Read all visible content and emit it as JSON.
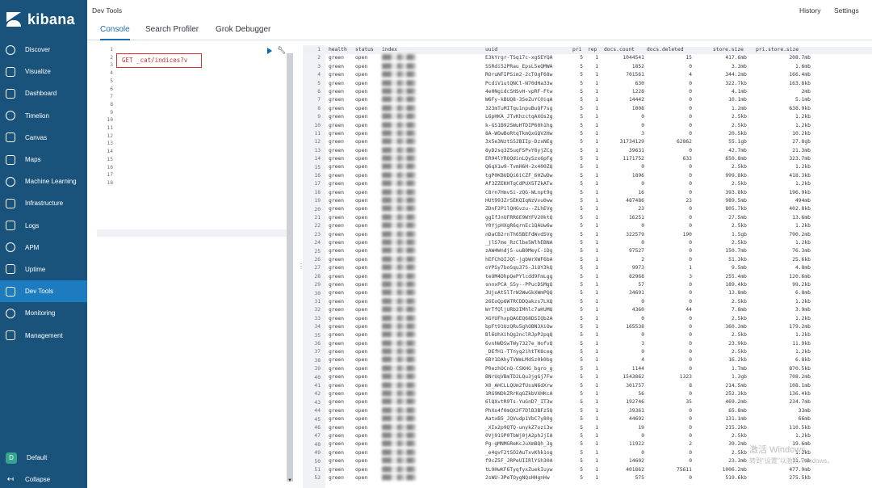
{
  "app": {
    "name": "kibana"
  },
  "nav": {
    "items": [
      {
        "label": "Discover",
        "icon": "compass-icon"
      },
      {
        "label": "Visualize",
        "icon": "bar-chart-icon"
      },
      {
        "label": "Dashboard",
        "icon": "dashboard-icon"
      },
      {
        "label": "Timelion",
        "icon": "shield-icon"
      },
      {
        "label": "Canvas",
        "icon": "canvas-icon"
      },
      {
        "label": "Maps",
        "icon": "map-icon"
      },
      {
        "label": "Machine Learning",
        "icon": "brain-icon"
      },
      {
        "label": "Infrastructure",
        "icon": "infrastructure-icon"
      },
      {
        "label": "Logs",
        "icon": "logs-icon"
      },
      {
        "label": "APM",
        "icon": "apm-icon"
      },
      {
        "label": "Uptime",
        "icon": "uptime-icon"
      },
      {
        "label": "Dev Tools",
        "icon": "wrench-icon",
        "active": true
      },
      {
        "label": "Monitoring",
        "icon": "heartbeat-icon"
      },
      {
        "label": "Management",
        "icon": "gear-icon"
      }
    ],
    "space": {
      "label": "Default",
      "initial": "D"
    },
    "collapse": {
      "label": "Collapse"
    }
  },
  "header": {
    "title": "Dev Tools",
    "history": "History",
    "settings": "Settings"
  },
  "tabs": [
    {
      "label": "Console",
      "active": true
    },
    {
      "label": "Search Profiler",
      "active": false
    },
    {
      "label": "Grok Debugger",
      "active": false
    }
  ],
  "request": {
    "line_count": 18,
    "text": "GET _cat/indices?v"
  },
  "response": {
    "headers": [
      "health",
      "status",
      "index",
      "uuid",
      "pri",
      "rep",
      "docs.count",
      "docs.deleted",
      "store.size",
      "pri.store.size"
    ],
    "rows": [
      [
        "green",
        "open",
        "",
        "E3kYrgr-TSq17c-xgSEYQA",
        "5",
        "1",
        "1044541",
        "15",
        "417.6mb",
        "208.7mb"
      ],
      [
        "green",
        "open",
        "",
        "SSRdi52PRau_EpsL5eQMWA",
        "5",
        "1",
        "1852",
        "0",
        "3.3mb",
        "1.6mb"
      ],
      [
        "green",
        "open",
        "",
        "ROruNFIPSim2-2cTOgF68w",
        "5",
        "1",
        "701561",
        "4",
        "344.2mb",
        "166.4mb"
      ],
      [
        "green",
        "open",
        "",
        "PcdiV1utQNCl-N70dHa33w",
        "5",
        "1",
        "630",
        "0",
        "322.7kb",
        "163.8kb"
      ],
      [
        "green",
        "open",
        "",
        "4e0NgidcSHSvH-vpRF-Ftw",
        "5",
        "1",
        "1228",
        "0",
        "4.1mb",
        "2mb"
      ],
      [
        "green",
        "open",
        "",
        "W6Fy-kBUQ8-3SeZuYC0iqA",
        "5",
        "1",
        "14442",
        "0",
        "10.1mb",
        "5.1mb"
      ],
      [
        "green",
        "open",
        "",
        "323mTuMITqu1npuBuQF7sg",
        "5",
        "1",
        "1008",
        "0",
        "1.2mb",
        "638.9kb"
      ],
      [
        "green",
        "open",
        "",
        "L6pHKA_JTvKhzctqAXOs2g",
        "5",
        "1",
        "0",
        "0",
        "2.5kb",
        "1.2kb"
      ],
      [
        "green",
        "open",
        "",
        "k-GS1B92SWuHTDIP60h1hg",
        "5",
        "1",
        "0",
        "0",
        "2.5kb",
        "1.2kb"
      ],
      [
        "green",
        "open",
        "",
        "8A-WOwBoRtqTkmQxGQV2Hw",
        "5",
        "1",
        "3",
        "0",
        "20.5kb",
        "10.2kb"
      ],
      [
        "green",
        "open",
        "",
        "3x5e3NztS52BIIp-DzxNEg",
        "5",
        "1",
        "31734129",
        "62862",
        "55.1gb",
        "27.8gb"
      ],
      [
        "green",
        "open",
        "",
        "8yD2sq3ZSuqFSPvY8yjZCg",
        "5",
        "1",
        "39631",
        "0",
        "42.7mb",
        "21.3mb"
      ],
      [
        "green",
        "open",
        "",
        "ER94lYROQdinLQySzx6pFg",
        "5",
        "1",
        "1171752",
        "633",
        "650.8mb",
        "323.7mb"
      ],
      [
        "green",
        "open",
        "",
        "Q6qX1w9-TvmH6H-2x400ZQ",
        "5",
        "1",
        "0",
        "0",
        "2.5kb",
        "1.2kb"
      ],
      [
        "green",
        "open",
        "",
        "tgP0KBUDQi6iCZF_6HZwDw",
        "5",
        "1",
        "1896",
        "0",
        "999.8kb",
        "418.3kb"
      ],
      [
        "green",
        "open",
        "",
        "Af3ZZEKHTqCdPUX5TZkATw",
        "5",
        "1",
        "0",
        "0",
        "2.5kb",
        "1.2kb"
      ],
      [
        "green",
        "open",
        "",
        "C8rn7HmvSi-zQG-WLnpt9g",
        "5",
        "1",
        "16",
        "0",
        "393.8kb",
        "196.9kb"
      ],
      [
        "green",
        "open",
        "",
        "HUt993ZrSEKQIqNzVvu0ww",
        "5",
        "1",
        "487486",
        "23",
        "989.5mb",
        "494mb"
      ],
      [
        "green",
        "open",
        "",
        "ZDnF2P1lQHGvzu--ZLhEVg",
        "5",
        "1",
        "23",
        "0",
        "805.7kb",
        "402.8kb"
      ],
      [
        "green",
        "open",
        "",
        "ggIfJnUFRR6E9WYFV20ktQ",
        "5",
        "1",
        "16251",
        "0",
        "27.5mb",
        "13.6mb"
      ],
      [
        "green",
        "open",
        "",
        "Y0YjpHXgR6qrnEc1QAUw6w",
        "5",
        "1",
        "0",
        "0",
        "2.5kb",
        "1.2kb"
      ],
      [
        "green",
        "open",
        "",
        "nDaCB2rnTh65BEFdWvdSVg",
        "5",
        "1",
        "322579",
        "190",
        "1.5gb",
        "790.2mb"
      ],
      [
        "green",
        "open",
        "",
        "_jlS7mo_RzClbe5WlhEBNA",
        "5",
        "1",
        "0",
        "0",
        "2.5kb",
        "1.2kb"
      ],
      [
        "green",
        "open",
        "",
        "zAW4WndjS-uuB0MeyC-iDg",
        "5",
        "1",
        "97527",
        "0",
        "150.7mb",
        "76.3mb"
      ],
      [
        "green",
        "open",
        "",
        "hEFChOIJQl-jgbWrXWF6bA",
        "5",
        "1",
        "2",
        "0",
        "51.3kb",
        "25.6kb"
      ],
      [
        "green",
        "open",
        "",
        "oYPSy7boSqu37S-JiOY3kQ",
        "5",
        "1",
        "9973",
        "1",
        "9.5mb",
        "4.8mb"
      ],
      [
        "green",
        "open",
        "",
        "teOM4DhpQePYlcdd9FmLgg",
        "5",
        "1",
        "82968",
        "3",
        "255.4mb",
        "120.6mb"
      ],
      [
        "green",
        "open",
        "",
        "snnxPCA_SSy--PPucDSMgQ",
        "5",
        "1",
        "57",
        "0",
        "189.4kb",
        "99.2kb"
      ],
      [
        "green",
        "open",
        "",
        "JUjoAt5lTrW2WwGkXWmPQQ",
        "5",
        "1",
        "34691",
        "0",
        "13.8mb",
        "6.8mb"
      ],
      [
        "green",
        "open",
        "",
        "26EoQp6WTRCDDQakzs7LXQ",
        "5",
        "1",
        "0",
        "0",
        "2.5kb",
        "1.2kb"
      ],
      [
        "green",
        "open",
        "",
        "WrTfQljURb2IMhlc7aKUMQ",
        "5",
        "1",
        "4360",
        "44",
        "7.8mb",
        "3.9mb"
      ],
      [
        "green",
        "open",
        "",
        "XGYUFhxpQAGEQ68DSIQb2A",
        "5",
        "1",
        "0",
        "0",
        "2.5kb",
        "1.2kb"
      ],
      [
        "green",
        "open",
        "",
        "bpFt91UzQRu5ghOBN3XiOw",
        "5",
        "1",
        "165538",
        "0",
        "360.3mb",
        "179.2mb"
      ],
      [
        "green",
        "open",
        "",
        "Bl6UhXihQg2nclRJpP2pqQ",
        "5",
        "1",
        "0",
        "0",
        "2.5kb",
        "1.2kb"
      ],
      [
        "green",
        "open",
        "",
        "6vnhWDSwTWy7327e_HofvQ",
        "5",
        "1",
        "3",
        "0",
        "23.9kb",
        "11.9kb"
      ],
      [
        "green",
        "open",
        "",
        "_DEfH1-TTnyq2ihtTK8ceg",
        "5",
        "1",
        "0",
        "0",
        "2.5kb",
        "1.2kb"
      ],
      [
        "green",
        "open",
        "",
        "6BY1DAhyTVWmLMdSz0k0bg",
        "5",
        "1",
        "4",
        "0",
        "16.2kb",
        "6.8kb"
      ],
      [
        "green",
        "open",
        "",
        "P0ezhOCnQ-CSKHG_bgro_g",
        "5",
        "1",
        "1144",
        "0",
        "1.7mb",
        "870.5kb"
      ],
      [
        "green",
        "open",
        "",
        "BNrUqVBmTD2LQu3jgGj7Fw",
        "5",
        "1",
        "1543862",
        "1323",
        "1.3gb",
        "708.2mb"
      ],
      [
        "green",
        "open",
        "",
        "X0_AHCLLQUm2fUssN6dXrw",
        "5",
        "1",
        "301757",
        "8",
        "214.5mb",
        "108.1mb"
      ],
      [
        "green",
        "open",
        "",
        "1RG9NDkZRrKqGZkbVXHKcA",
        "5",
        "1",
        "56",
        "0",
        "252.3kb",
        "136.4kb"
      ],
      [
        "green",
        "open",
        "",
        "6lQXvtR9Ts-YuGnD7_IT3w",
        "5",
        "1",
        "192746",
        "35",
        "469.2mb",
        "234.7mb"
      ],
      [
        "green",
        "open",
        "",
        "PhXs4f0mQX2F7DlB3BFz5Q",
        "5",
        "1",
        "39361",
        "0",
        "65.8mb",
        "33mb"
      ],
      [
        "green",
        "open",
        "",
        "AatxB5_JQVudp1VbC7y80g",
        "5",
        "1",
        "44692",
        "0",
        "131.1mb",
        "66mb"
      ],
      [
        "green",
        "open",
        "",
        "_XIx2p9QTQ-unykZ7ozi3w",
        "5",
        "1",
        "19",
        "0",
        "215.2kb",
        "110.5kb"
      ],
      [
        "green",
        "open",
        "",
        "0Vj91SP0TbWj0jA2phJjIA",
        "5",
        "1",
        "0",
        "0",
        "2.5kb",
        "1.2kb"
      ],
      [
        "green",
        "open",
        "",
        "Pg-gMNMGReKcJuXmBQh_3g",
        "5",
        "1",
        "11922",
        "2",
        "39.2mb",
        "19.6mb"
      ],
      [
        "green",
        "open",
        "",
        "_e4gvF2tSO2AuTxvKhk1og",
        "5",
        "1",
        "0",
        "0",
        "2.5kb",
        "1.2kb"
      ],
      [
        "green",
        "open",
        "",
        "f9cZ5F_JRPeUIIRlYSh30A",
        "5",
        "1",
        "14602",
        "0",
        "23.3mb",
        "11.7mb"
      ],
      [
        "green",
        "open",
        "",
        "tL9HwKF6TyqfyxZuekIuyw",
        "5",
        "1",
        "401862",
        "75611",
        "1006.2mb",
        "477.9mb"
      ],
      [
        "green",
        "open",
        "",
        "2sWU-3PeTOygNQsHHgnHw",
        "5",
        "1",
        "575",
        "0",
        "519.6kb",
        "275.5kb"
      ]
    ]
  },
  "watermark": {
    "line1": "激活 Windows",
    "line2": "转到\"设置\"以激活 Windows。"
  }
}
